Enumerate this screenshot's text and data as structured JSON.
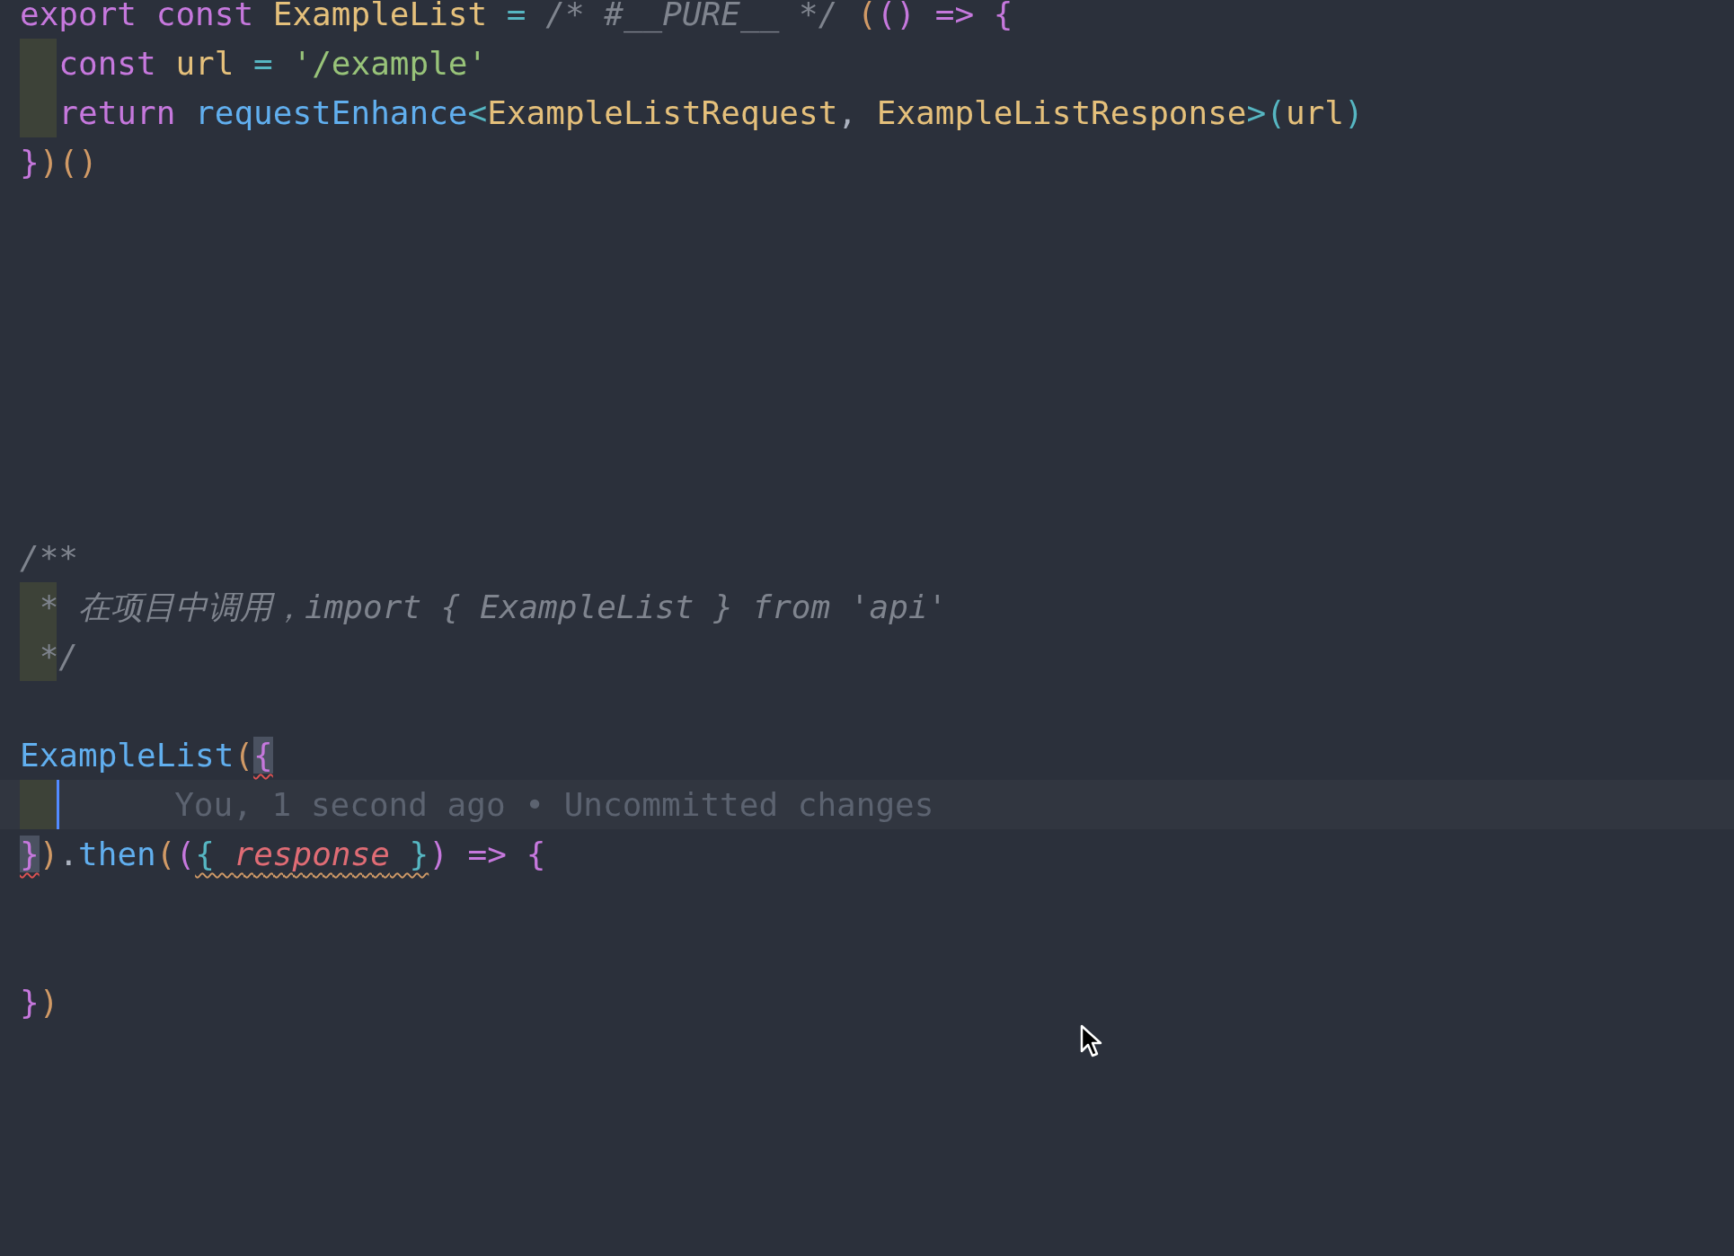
{
  "editor": {
    "lines": [
      {
        "kind": "code",
        "indent_guide": false,
        "tokens": [
          {
            "kind": "keyword",
            "text": "export const "
          },
          {
            "kind": "type",
            "text": "ExampleList"
          },
          {
            "kind": "operator",
            "text": " = "
          },
          {
            "kind": "comment",
            "text": "/* #__PURE__ */ "
          },
          {
            "kind": "bracket-a",
            "text": "("
          },
          {
            "kind": "bracket-b",
            "text": "()"
          },
          {
            "kind": "keyword",
            "text": " => {"
          }
        ]
      },
      {
        "kind": "code",
        "indent_guide": true,
        "tokens": [
          {
            "kind": "keyword",
            "text": "  const "
          },
          {
            "kind": "type",
            "text": "url"
          },
          {
            "kind": "operator",
            "text": " = "
          },
          {
            "kind": "string",
            "text": "'/example'"
          }
        ]
      },
      {
        "kind": "code",
        "indent_guide": true,
        "tokens": [
          {
            "kind": "keyword",
            "text": "  return "
          },
          {
            "kind": "function",
            "text": "requestEnhance"
          },
          {
            "kind": "operator",
            "text": "<"
          },
          {
            "kind": "type",
            "text": "ExampleListRequest"
          },
          {
            "kind": "plain",
            "text": ", "
          },
          {
            "kind": "type",
            "text": "ExampleListResponse"
          },
          {
            "kind": "operator",
            "text": ">("
          },
          {
            "kind": "type",
            "text": "url"
          },
          {
            "kind": "operator",
            "text": ")"
          }
        ]
      },
      {
        "kind": "code",
        "indent_guide": false,
        "tokens": [
          {
            "kind": "keyword",
            "text": "}"
          },
          {
            "kind": "bracket-a",
            "text": ")()"
          }
        ]
      },
      {
        "kind": "blank"
      },
      {
        "kind": "blank"
      },
      {
        "kind": "blank"
      },
      {
        "kind": "blank"
      },
      {
        "kind": "blank"
      },
      {
        "kind": "blank"
      },
      {
        "kind": "blank"
      },
      {
        "kind": "code",
        "indent_guide": false,
        "tokens": [
          {
            "kind": "comment",
            "text": "/**"
          }
        ]
      },
      {
        "kind": "code",
        "indent_guide": true,
        "tokens": [
          {
            "kind": "comment",
            "text": " * 在项目中调用，import { ExampleList } from 'api'"
          }
        ]
      },
      {
        "kind": "code",
        "indent_guide": true,
        "tokens": [
          {
            "kind": "comment",
            "text": " */"
          }
        ]
      },
      {
        "kind": "blank"
      },
      {
        "kind": "code",
        "indent_guide": false,
        "tokens": [
          {
            "kind": "function",
            "text": "ExampleList"
          },
          {
            "kind": "bracket-a",
            "text": "("
          },
          {
            "kind": "bracket-b",
            "text": "{",
            "matched": true,
            "error": true
          }
        ]
      },
      {
        "kind": "blame",
        "indent_guide": true,
        "text": "You, 1 second ago • Uncommitted changes"
      },
      {
        "kind": "code",
        "indent_guide": false,
        "tokens": [
          {
            "kind": "bracket-b",
            "text": "}",
            "matched": true,
            "error": true
          },
          {
            "kind": "bracket-a",
            "text": ")"
          },
          {
            "kind": "plain",
            "text": "."
          },
          {
            "kind": "function",
            "text": "then"
          },
          {
            "kind": "bracket-a",
            "text": "("
          },
          {
            "kind": "bracket-b",
            "text": "("
          },
          {
            "kind": "bracket-c",
            "text": "{ ",
            "warning": true
          },
          {
            "kind": "param",
            "text": "response",
            "warning": true
          },
          {
            "kind": "bracket-c",
            "text": " }",
            "warning": true
          },
          {
            "kind": "bracket-b",
            "text": ")"
          },
          {
            "kind": "keyword",
            "text": " => "
          },
          {
            "kind": "bracket-b",
            "text": "{"
          }
        ]
      },
      {
        "kind": "blank"
      },
      {
        "kind": "blank"
      },
      {
        "kind": "code",
        "indent_guide": false,
        "tokens": [
          {
            "kind": "bracket-b",
            "text": "}"
          },
          {
            "kind": "bracket-a",
            "text": ")"
          }
        ]
      }
    ]
  }
}
